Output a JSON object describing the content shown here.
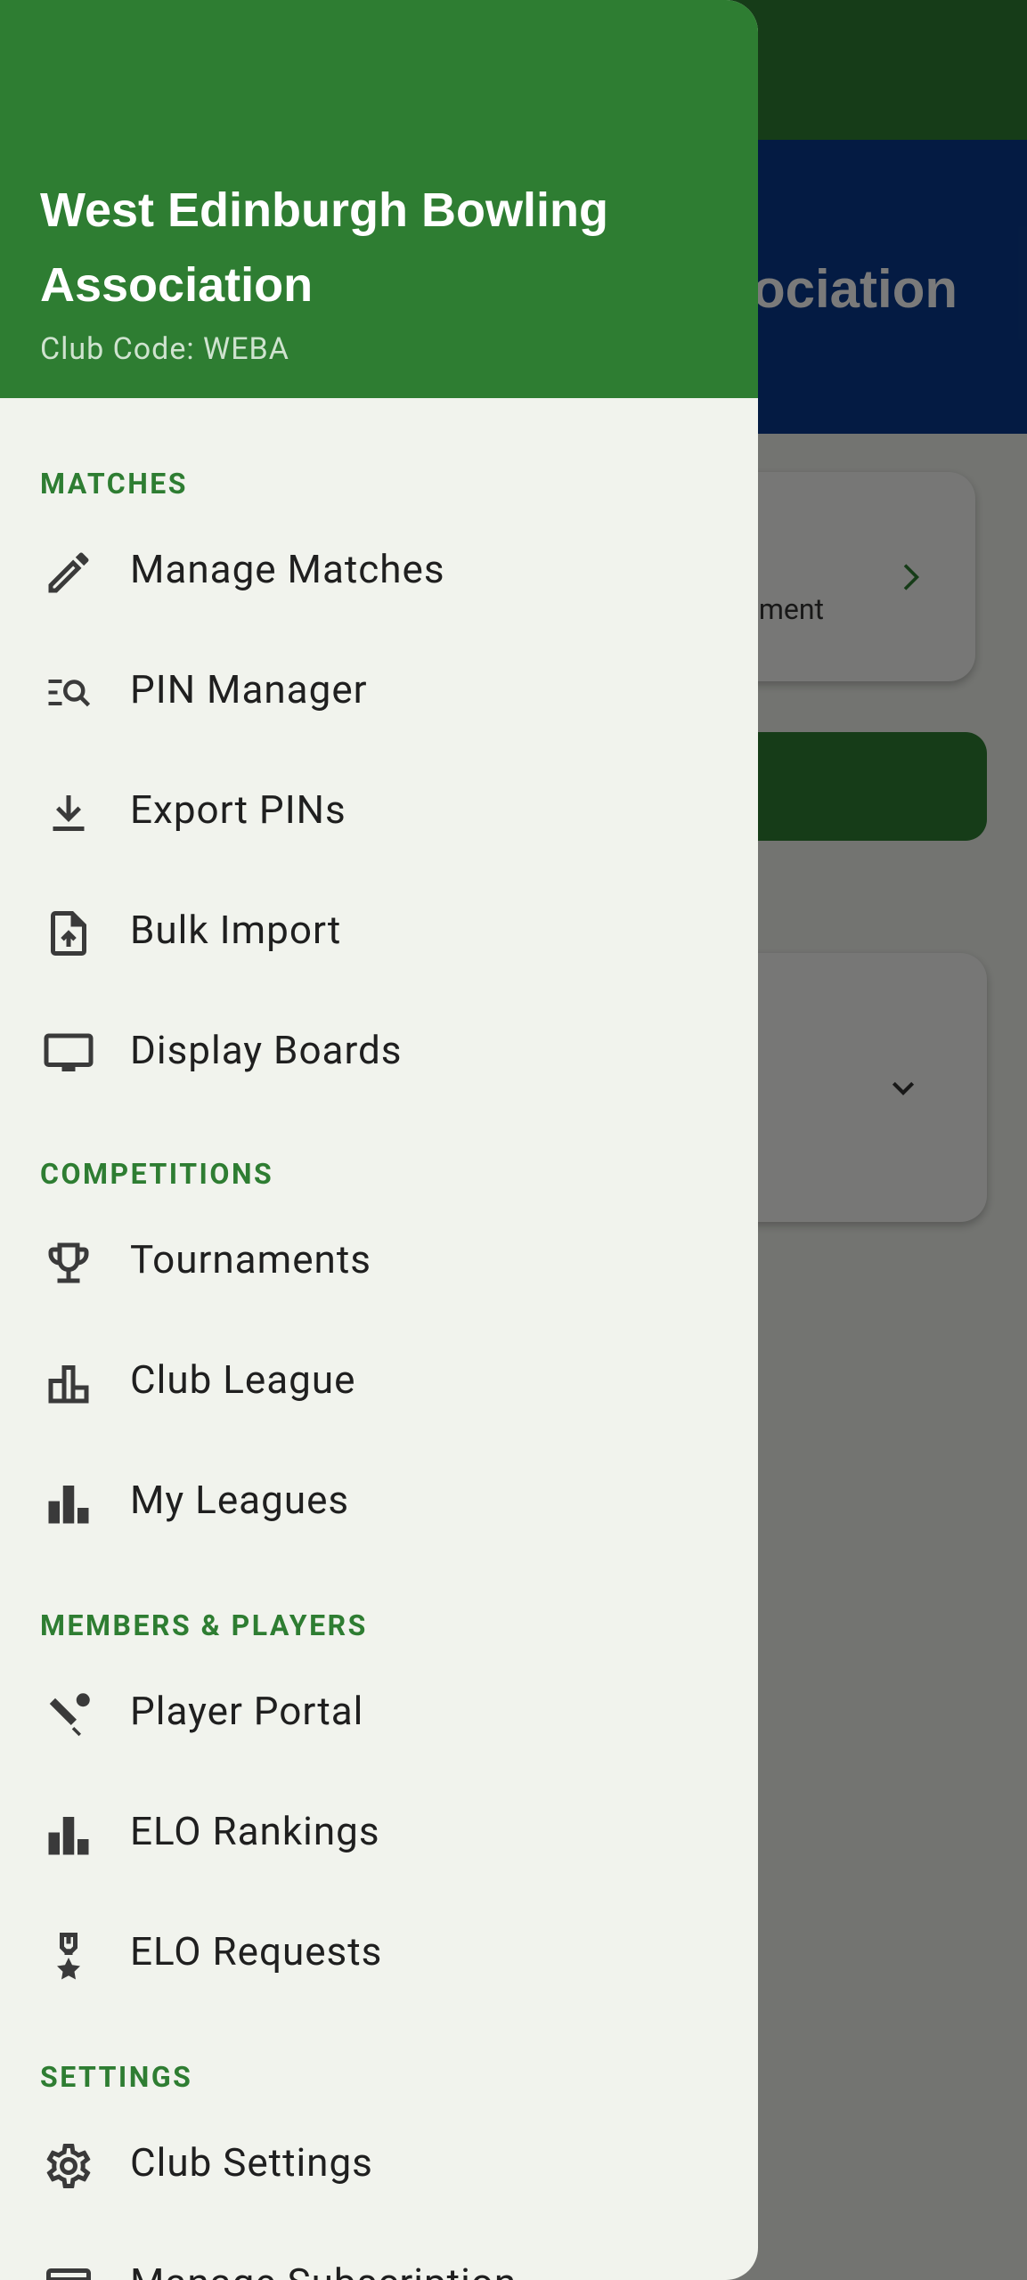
{
  "background": {
    "hero_title_fragment": "sociation",
    "card_text_fragment": "ment"
  },
  "drawer": {
    "club_name": "West Edinburgh Bowling Association",
    "club_code": "Club Code: WEBA",
    "sections": {
      "matches": "MATCHES",
      "competitions": "COMPETITIONS",
      "members": "MEMBERS & PLAYERS",
      "settings": "SETTINGS"
    },
    "items": {
      "manage_matches": "Manage Matches",
      "pin_manager": "PIN Manager",
      "export_pins": "Export PINs",
      "bulk_import": "Bulk Import",
      "display_boards": "Display Boards",
      "tournaments": "Tournaments",
      "club_league": "Club League",
      "my_leagues": "My Leagues",
      "player_portal": "Player Portal",
      "elo_rankings": "ELO Rankings",
      "elo_requests": "ELO Requests",
      "club_settings": "Club Settings",
      "manage_subscription": "Manage Subscription"
    }
  },
  "icons": {
    "manage_matches": "pencil-icon",
    "pin_manager": "list-search-icon",
    "export_pins": "download-icon",
    "bulk_import": "file-upload-icon",
    "display_boards": "monitor-icon",
    "tournaments": "trophy-icon",
    "club_league": "podium-icon",
    "my_leagues": "bar-chart-icon",
    "player_portal": "bowling-icon",
    "elo_rankings": "bar-chart-icon",
    "elo_requests": "medal-icon",
    "club_settings": "gear-icon",
    "manage_subscription": "card-icon"
  },
  "colors": {
    "primary_green": "#2e7d32",
    "hero_blue": "#0a3a8c",
    "drawer_bg": "#f1f3ed",
    "section_label": "#2e7d32"
  }
}
